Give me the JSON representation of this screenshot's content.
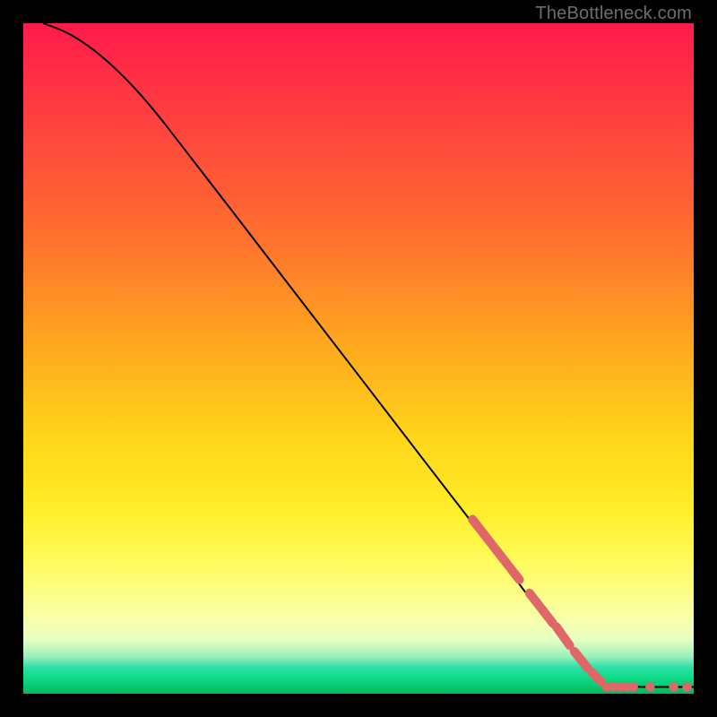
{
  "watermark": "TheBottleneck.com",
  "chart_data": {
    "type": "line",
    "title": "",
    "xlabel": "",
    "ylabel": "",
    "xlim": [
      0,
      100
    ],
    "ylim": [
      0,
      100
    ],
    "curve": [
      {
        "x": 3,
        "y": 100
      },
      {
        "x": 7,
        "y": 98.5
      },
      {
        "x": 12,
        "y": 95
      },
      {
        "x": 18,
        "y": 89
      },
      {
        "x": 25,
        "y": 80
      },
      {
        "x": 35,
        "y": 67
      },
      {
        "x": 45,
        "y": 54
      },
      {
        "x": 55,
        "y": 41
      },
      {
        "x": 65,
        "y": 28
      },
      {
        "x": 72,
        "y": 19
      },
      {
        "x": 78,
        "y": 11
      },
      {
        "x": 83,
        "y": 5
      },
      {
        "x": 86,
        "y": 2
      },
      {
        "x": 88,
        "y": 1
      },
      {
        "x": 100,
        "y": 1
      }
    ],
    "highlight_segments": [
      {
        "x1": 67,
        "y1": 26,
        "x2": 74,
        "y2": 17
      },
      {
        "x1": 75.5,
        "y1": 15,
        "x2": 79,
        "y2": 10.5
      },
      {
        "x1": 79.5,
        "y1": 10,
        "x2": 81.5,
        "y2": 7.2
      },
      {
        "x1": 82.2,
        "y1": 6.3,
        "x2": 84.2,
        "y2": 3.8
      },
      {
        "x1": 84.8,
        "y1": 3.2,
        "x2": 86.2,
        "y2": 1.8
      }
    ],
    "highlight_points_flat": [
      {
        "x": 87,
        "y": 1
      },
      {
        "x": 88,
        "y": 1
      },
      {
        "x": 89,
        "y": 1
      },
      {
        "x": 90,
        "y": 1
      },
      {
        "x": 91,
        "y": 1
      },
      {
        "x": 93.5,
        "y": 1
      },
      {
        "x": 97,
        "y": 1
      },
      {
        "x": 99,
        "y": 1
      }
    ]
  }
}
